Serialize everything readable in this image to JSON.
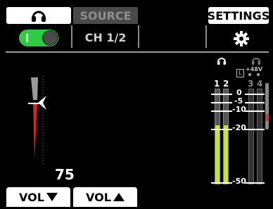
{
  "tabs": {
    "monitor": {
      "icon": "headphones-icon"
    },
    "source": {
      "label": "SOURCE"
    },
    "settings": {
      "label": "SETTINGS"
    }
  },
  "monitor_toggle": {
    "state": "on",
    "color": "#2ecc40"
  },
  "source": {
    "channel": "CH 1/2"
  },
  "settings": {
    "icon": "gear-icon"
  },
  "volume": {
    "value": "75",
    "fill_fraction": 0.75,
    "down_label": "VOL",
    "up_label": "VOL"
  },
  "meters": {
    "left_group": {
      "icon": "headphones-icon",
      "channels": [
        "1",
        "2"
      ]
    },
    "right_group": {
      "icon": "headphones-icon",
      "badge": "L",
      "phantom_power": "+48V",
      "channels": [
        "3",
        "4"
      ]
    },
    "scale": [
      "0",
      "-5",
      "-10",
      "-20",
      "-50"
    ],
    "level_color": "#c6e23a",
    "clip_color": "#e53030"
  }
}
